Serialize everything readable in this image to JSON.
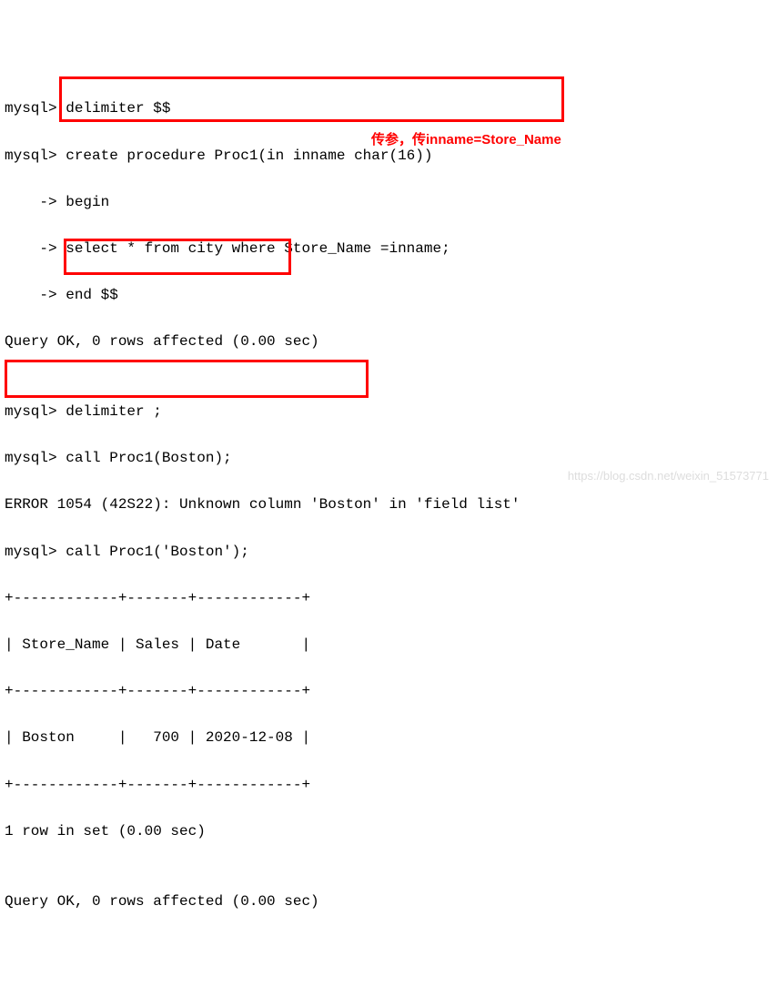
{
  "lines": {
    "l1": "mysql> delimiter $$",
    "l2": "mysql> create procedure Proc1(in inname char(16))",
    "l3": "    -> begin",
    "l4": "    -> select * from city where Store_Name =inname;",
    "l5": "    -> end $$",
    "l6": "Query OK, 0 rows affected (0.00 sec)",
    "l7": "",
    "l8": "mysql> delimiter ;",
    "l9": "mysql> call Proc1(Boston);",
    "l10": "ERROR 1054 (42S22): Unknown column 'Boston' in 'field list'",
    "l11": "mysql> call Proc1('Boston');",
    "l12": "+------------+-------+------------+",
    "l13": "| Store_Name | Sales | Date       |",
    "l14": "+------------+-------+------------+",
    "l15": "| Boston     |   700 | 2020-12-08 |",
    "l16": "+------------+-------+------------+",
    "l17": "1 row in set (0.00 sec)",
    "l18": "",
    "l19": "Query OK, 0 rows affected (0.00 sec)"
  },
  "annotation": "传参，传inname=Store_Name",
  "watermark": "https://blog.csdn.net/weixin_51573771"
}
